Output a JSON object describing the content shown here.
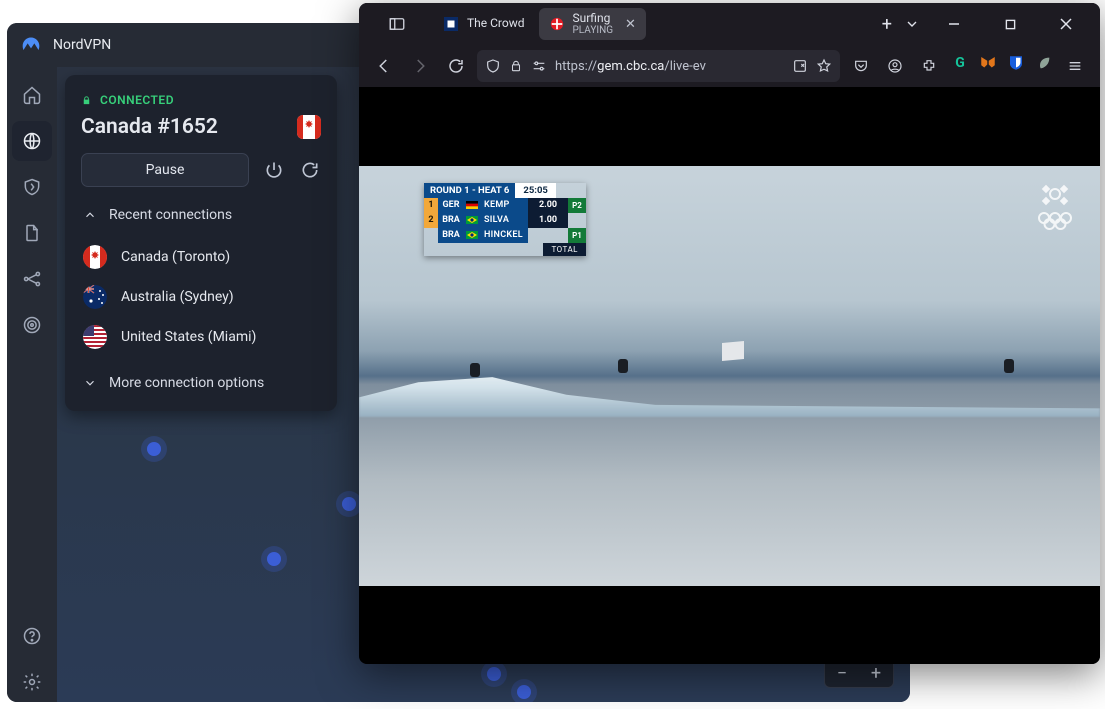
{
  "nordvpn": {
    "title": "NordVPN",
    "status_label": "CONNECTED",
    "server_name": "Canada #1652",
    "pause_label": "Pause",
    "recent_header": "Recent connections",
    "recent": [
      {
        "label": "Canada (Toronto)"
      },
      {
        "label": "Australia (Sydney)"
      },
      {
        "label": "United States (Miami)"
      }
    ],
    "more_label": "More connection options",
    "zoom_minus": "−",
    "zoom_plus": "+"
  },
  "browser": {
    "tabs": [
      {
        "title": "The Crowd",
        "active": false
      },
      {
        "title": "Surfing",
        "subtitle": "PLAYING",
        "active": true
      }
    ],
    "url_prefix": "https://",
    "url_domain": "gem.cbc.ca",
    "url_path": "/live-ev",
    "new_tab_plus": "+"
  },
  "scoreboard": {
    "header_label": "ROUND 1 - HEAT 6",
    "header_time": "25:05",
    "total_label": "TOTAL",
    "rows": [
      {
        "rank": "1",
        "country": "GER",
        "name": "KEMP",
        "score": "2.00",
        "badge": "P2"
      },
      {
        "rank": "2",
        "country": "BRA",
        "name": "SILVA",
        "score": "1.00",
        "badge": ""
      },
      {
        "rank": "",
        "country": "BRA",
        "name": "HINCKEL",
        "score": "",
        "badge": "P1"
      }
    ]
  }
}
